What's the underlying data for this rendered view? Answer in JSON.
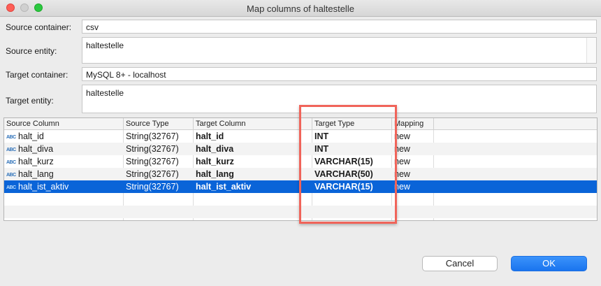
{
  "window": {
    "title": "Map columns of haltestelle"
  },
  "form": {
    "source_container_label": "Source container:",
    "source_container_value": "csv",
    "source_entity_label": "Source entity:",
    "source_entity_value": "haltestelle",
    "target_container_label": "Target container:",
    "target_container_value": "MySQL 8+ - localhost",
    "target_entity_label": "Target entity:",
    "target_entity_value": "haltestelle"
  },
  "table": {
    "columns": [
      "Source Column",
      "Source Type",
      "Target Column",
      "Target Type",
      "Mapping"
    ],
    "type_icon": "ABC",
    "rows": [
      {
        "source_column": "halt_id",
        "source_type": "String(32767)",
        "target_column": "halt_id",
        "target_type": "INT",
        "mapping": "new"
      },
      {
        "source_column": "halt_diva",
        "source_type": "String(32767)",
        "target_column": "halt_diva",
        "target_type": "INT",
        "mapping": "new"
      },
      {
        "source_column": "halt_kurz",
        "source_type": "String(32767)",
        "target_column": "halt_kurz",
        "target_type": "VARCHAR(15)",
        "mapping": "new"
      },
      {
        "source_column": "halt_lang",
        "source_type": "String(32767)",
        "target_column": "halt_lang",
        "target_type": "VARCHAR(50)",
        "mapping": "new"
      },
      {
        "source_column": "halt_ist_aktiv",
        "source_type": "String(32767)",
        "target_column": "halt_ist_aktiv",
        "target_type": "VARCHAR(15)",
        "mapping": "new",
        "selected": true
      }
    ]
  },
  "buttons": {
    "cancel_label": "Cancel",
    "ok_label": "OK"
  },
  "colors": {
    "selection": "#0a64d8",
    "highlight": "#f0645a",
    "ok_button": "#1a74ee"
  },
  "icons": {
    "type": "abc-string-icon"
  }
}
